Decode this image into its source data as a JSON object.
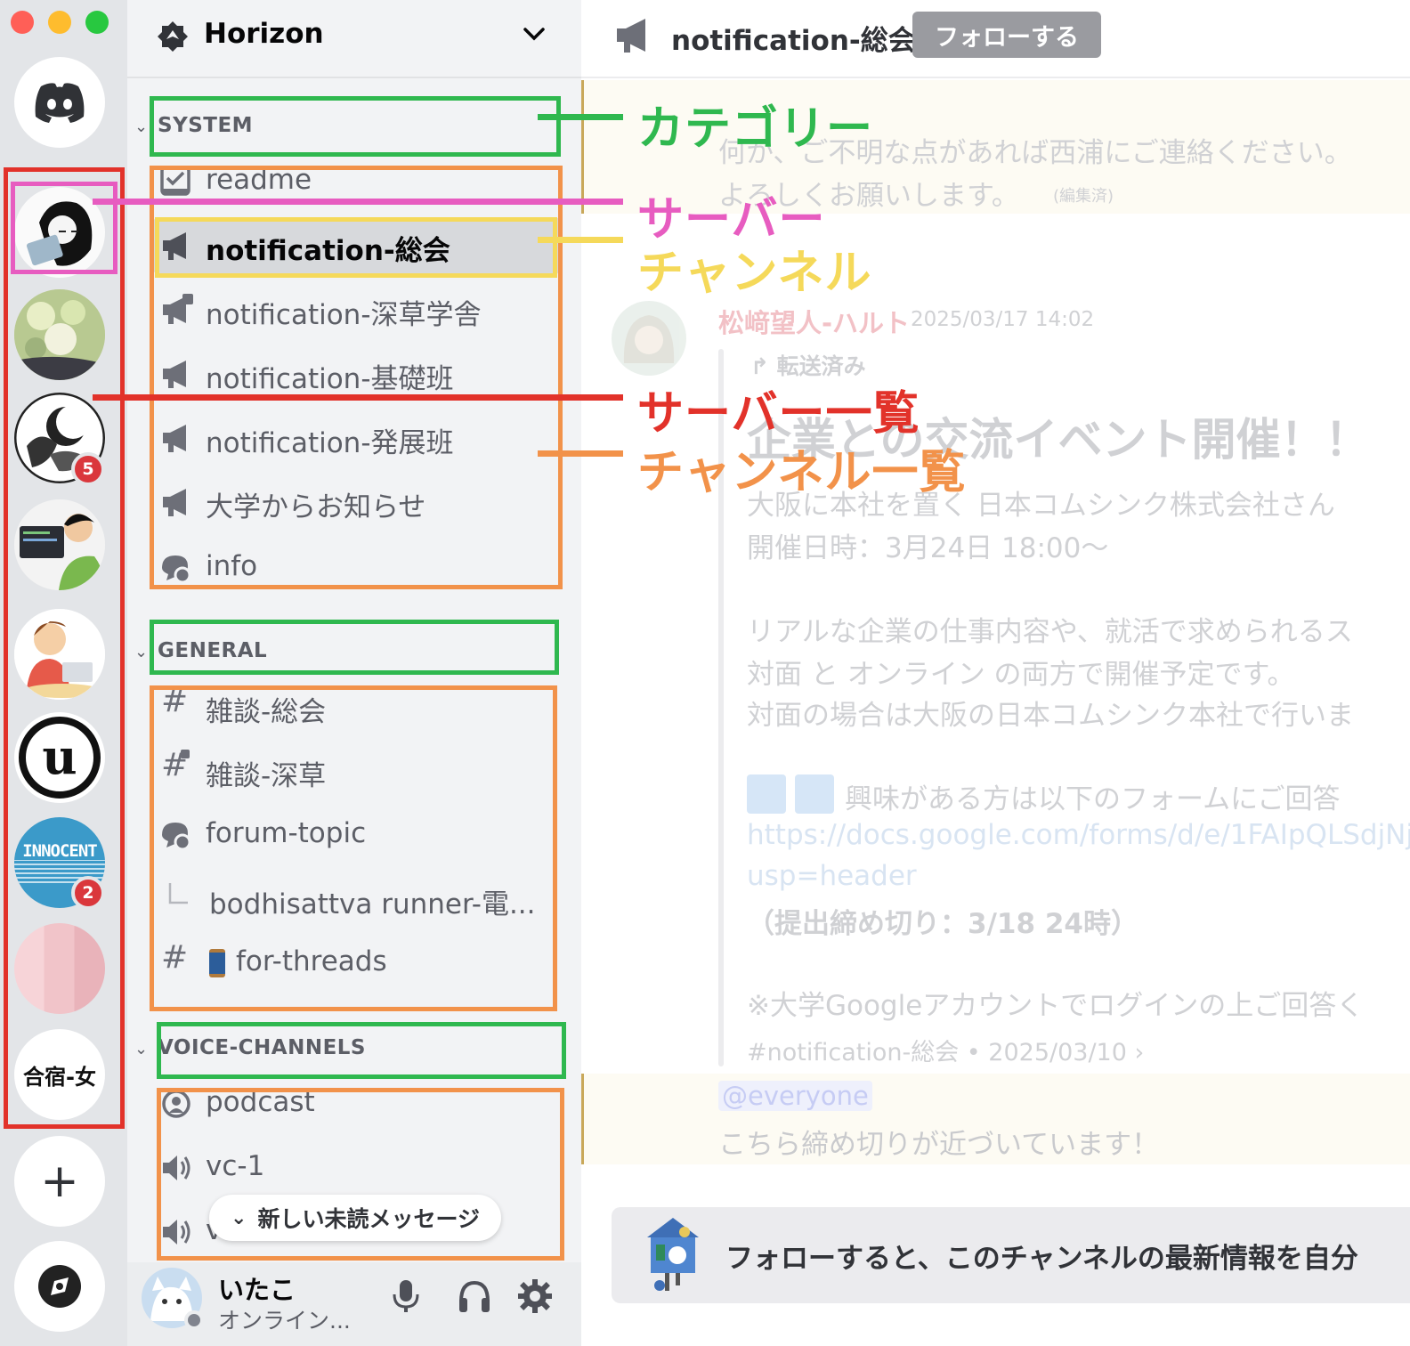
{
  "colors": {
    "category": "#2fb84f",
    "server": "#e75cc0",
    "channel": "#f5d95a",
    "server_list": "#e2322a",
    "channel_list": "#f2924a"
  },
  "servers": [
    {
      "icon": "discord-logo-icon"
    },
    {
      "icon": "server-avatar-person-laptop",
      "selected": true
    },
    {
      "icon": "server-avatar-food"
    },
    {
      "icon": "server-avatar-moon-bird",
      "badge": "5"
    },
    {
      "icon": "server-avatar-coder"
    },
    {
      "icon": "server-avatar-kid-laptop"
    },
    {
      "icon": "server-avatar-unreal"
    },
    {
      "icon": "server-avatar-innocent",
      "label": "INNOCENT",
      "badge": "2"
    },
    {
      "icon": "server-avatar-pink"
    },
    {
      "icon": "server-avatar-text",
      "label": "合宿-女"
    },
    {
      "icon": "add-server-icon"
    },
    {
      "icon": "discover-icon"
    }
  ],
  "guild": {
    "name": "Horizon"
  },
  "categories": {
    "system": "SYSTEM",
    "general": "GENERAL",
    "voice": "VOICE-CHANNELS"
  },
  "channels": {
    "readme": "readme",
    "n_sokai": "notification-総会",
    "n_fukakusa": "notification-深草学舎",
    "n_kiso": "notification-基礎班",
    "n_hatten": "notification-発展班",
    "daigaku": "大学からお知らせ",
    "info": "info",
    "zatsudan_sokai": "雑談-総会",
    "zatsudan_fukakusa": "雑談-深草",
    "forum": "forum-topic",
    "thread": "bodhisattva runner-電...",
    "threads": "for-threads",
    "podcast": "podcast",
    "vc1": "vc-1",
    "vc2": "vc-2"
  },
  "unread_pill": "新しい未読メッセージ",
  "user": {
    "name": "いたこ",
    "status": "オンライン..."
  },
  "main": {
    "channel_title": "notification-総会",
    "follow_button": "フォローする",
    "msg1_line1": "何か、ご不明な点があれば西浦にご連絡ください。",
    "msg1_line2": "よろしくお願いします。",
    "edited": "(編集済)",
    "author": "松﨑望人-ハルト",
    "timestamp": "2025/03/17 14:02",
    "forwarded": "転送済み",
    "event_title": "企業との交流イベント開催！！",
    "body1": "大阪に本社を置く 日本コムシンク株式会社さん",
    "body2": "開催日時：3月24日 18:00〜",
    "body3": "リアルな企業の仕事内容や、就活で求められるス",
    "body4": "対面 と オンライン の両方で開催予定です。",
    "body5": "対面の場合は大阪の日本コムシンク本社で行いま",
    "body6": "興味がある方は以下のフォームにご回答",
    "link1": "https://docs.google.com/forms/d/e/1FAIpQLSdjNj",
    "link2": "usp=header",
    "deadline": "（提出締め切り：3/18 24時）",
    "note": "※大学Googleアカウントでログインの上ご回答く",
    "source": "#notification-総会 • 2025/03/10 ›",
    "mention": "@everyone",
    "msg2": "こちら締め切りが近づいています！",
    "banner": "フォローすると、このチャンネルの最新情報を自分"
  },
  "annotations": {
    "category": "カテゴリー",
    "server": "サーバー",
    "channel": "チャンネル",
    "server_list": "サーバー一覧",
    "channel_list": "チャンネル一覧"
  }
}
